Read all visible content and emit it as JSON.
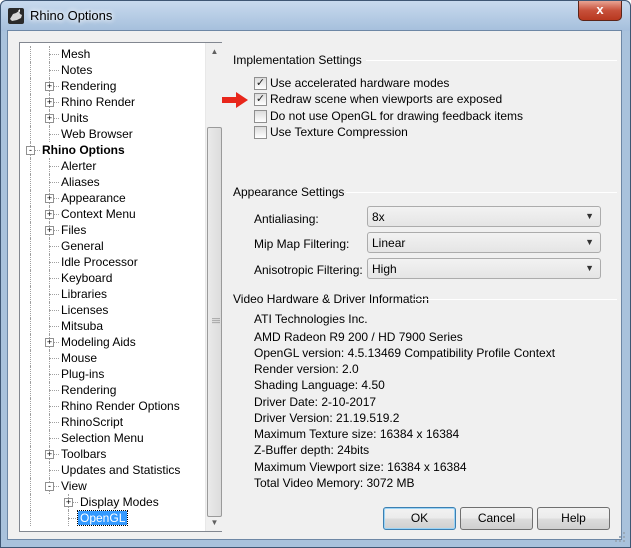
{
  "window": {
    "title": "Rhino Options",
    "close_label": "x"
  },
  "tree": {
    "items": [
      {
        "label": "Mesh",
        "level": 2,
        "expander": "",
        "bold": false,
        "selected": false
      },
      {
        "label": "Notes",
        "level": 2,
        "expander": "",
        "bold": false,
        "selected": false
      },
      {
        "label": "Rendering",
        "level": 2,
        "expander": "+",
        "bold": false,
        "selected": false
      },
      {
        "label": "Rhino Render",
        "level": 2,
        "expander": "+",
        "bold": false,
        "selected": false
      },
      {
        "label": "Units",
        "level": 2,
        "expander": "+",
        "bold": false,
        "selected": false
      },
      {
        "label": "Web Browser",
        "level": 2,
        "expander": "",
        "bold": false,
        "selected": false
      },
      {
        "label": "Rhino Options",
        "level": 1,
        "expander": "-",
        "bold": true,
        "selected": false
      },
      {
        "label": "Alerter",
        "level": 2,
        "expander": "",
        "bold": false,
        "selected": false
      },
      {
        "label": "Aliases",
        "level": 2,
        "expander": "",
        "bold": false,
        "selected": false
      },
      {
        "label": "Appearance",
        "level": 2,
        "expander": "+",
        "bold": false,
        "selected": false
      },
      {
        "label": "Context Menu",
        "level": 2,
        "expander": "+",
        "bold": false,
        "selected": false
      },
      {
        "label": "Files",
        "level": 2,
        "expander": "+",
        "bold": false,
        "selected": false
      },
      {
        "label": "General",
        "level": 2,
        "expander": "",
        "bold": false,
        "selected": false
      },
      {
        "label": "Idle Processor",
        "level": 2,
        "expander": "",
        "bold": false,
        "selected": false
      },
      {
        "label": "Keyboard",
        "level": 2,
        "expander": "",
        "bold": false,
        "selected": false
      },
      {
        "label": "Libraries",
        "level": 2,
        "expander": "",
        "bold": false,
        "selected": false
      },
      {
        "label": "Licenses",
        "level": 2,
        "expander": "",
        "bold": false,
        "selected": false
      },
      {
        "label": "Mitsuba",
        "level": 2,
        "expander": "",
        "bold": false,
        "selected": false
      },
      {
        "label": "Modeling Aids",
        "level": 2,
        "expander": "+",
        "bold": false,
        "selected": false
      },
      {
        "label": "Mouse",
        "level": 2,
        "expander": "",
        "bold": false,
        "selected": false
      },
      {
        "label": "Plug-ins",
        "level": 2,
        "expander": "",
        "bold": false,
        "selected": false
      },
      {
        "label": "Rendering",
        "level": 2,
        "expander": "",
        "bold": false,
        "selected": false
      },
      {
        "label": "Rhino Render Options",
        "level": 2,
        "expander": "",
        "bold": false,
        "selected": false
      },
      {
        "label": "RhinoScript",
        "level": 2,
        "expander": "",
        "bold": false,
        "selected": false
      },
      {
        "label": "Selection Menu",
        "level": 2,
        "expander": "",
        "bold": false,
        "selected": false
      },
      {
        "label": "Toolbars",
        "level": 2,
        "expander": "+",
        "bold": false,
        "selected": false
      },
      {
        "label": "Updates and Statistics",
        "level": 2,
        "expander": "",
        "bold": false,
        "selected": false
      },
      {
        "label": "View",
        "level": 2,
        "expander": "-",
        "bold": false,
        "selected": false
      },
      {
        "label": "Display Modes",
        "level": 3,
        "expander": "+",
        "bold": false,
        "selected": false
      },
      {
        "label": "OpenGL",
        "level": 3,
        "expander": "",
        "bold": false,
        "selected": true
      }
    ]
  },
  "implementation": {
    "title": "Implementation Settings",
    "options": [
      {
        "label": "Use accelerated hardware modes",
        "checked": true
      },
      {
        "label": "Redraw scene when viewports are exposed",
        "checked": true
      },
      {
        "label": "Do not use OpenGL for drawing feedback items",
        "checked": false
      },
      {
        "label": "Use Texture Compression",
        "checked": false
      }
    ],
    "checkmark": "✓"
  },
  "appearance": {
    "title": "Appearance Settings",
    "fields": [
      {
        "label": "Antialiasing:",
        "value": "8x"
      },
      {
        "label": "Mip Map Filtering:",
        "value": "Linear"
      },
      {
        "label": "Anisotropic Filtering:",
        "value": "High"
      }
    ],
    "caret": "▼"
  },
  "video": {
    "title": "Video Hardware & Driver Information",
    "lines": [
      "ATI Technologies Inc.",
      "AMD Radeon R9 200 / HD 7900 Series",
      "OpenGL version: 4.5.13469 Compatibility Profile Context",
      "Render version: 2.0",
      "Shading Language: 4.50",
      "Driver Date: 2-10-2017",
      "Driver Version: 21.19.519.2",
      "Maximum Texture size: 16384 x 16384",
      "Z-Buffer depth: 24bits",
      "Maximum Viewport size: 16384 x 16384",
      "Total Video Memory: 3072 MB"
    ]
  },
  "buttons": {
    "ok": "OK",
    "cancel": "Cancel",
    "help": "Help"
  },
  "scrollbar": {
    "up": "▲",
    "down": "▼"
  },
  "colors": {
    "selection": "#3399ff",
    "arrow": "#e8261b"
  }
}
